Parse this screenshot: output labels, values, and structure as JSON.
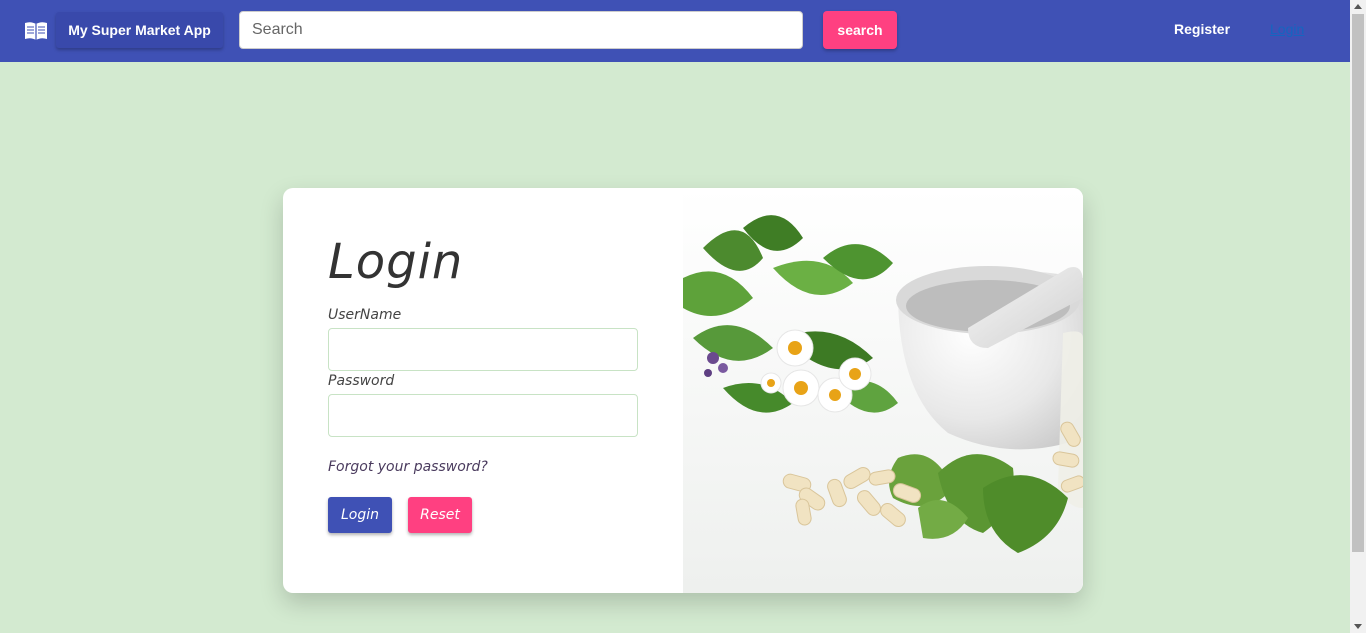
{
  "navbar": {
    "icon": "book-open-icon",
    "brand_label": "My Super Market App",
    "search_placeholder": "Search",
    "search_value": "",
    "search_button_label": "search",
    "register_label": "Register",
    "login_label": "Login"
  },
  "login_form": {
    "title": "Login",
    "username_label": "UserName",
    "username_value": "",
    "password_label": "Password",
    "password_value": "",
    "forgot_label": "Forgot your password?",
    "login_button_label": "Login",
    "reset_button_label": "Reset"
  },
  "image": {
    "subject": "herbs-mortar-pestle-capsules-image"
  },
  "colors": {
    "navbar": "#3f51b5",
    "accent": "#ff4081",
    "page_background": "#d3ead0",
    "link": "#1565c0"
  }
}
